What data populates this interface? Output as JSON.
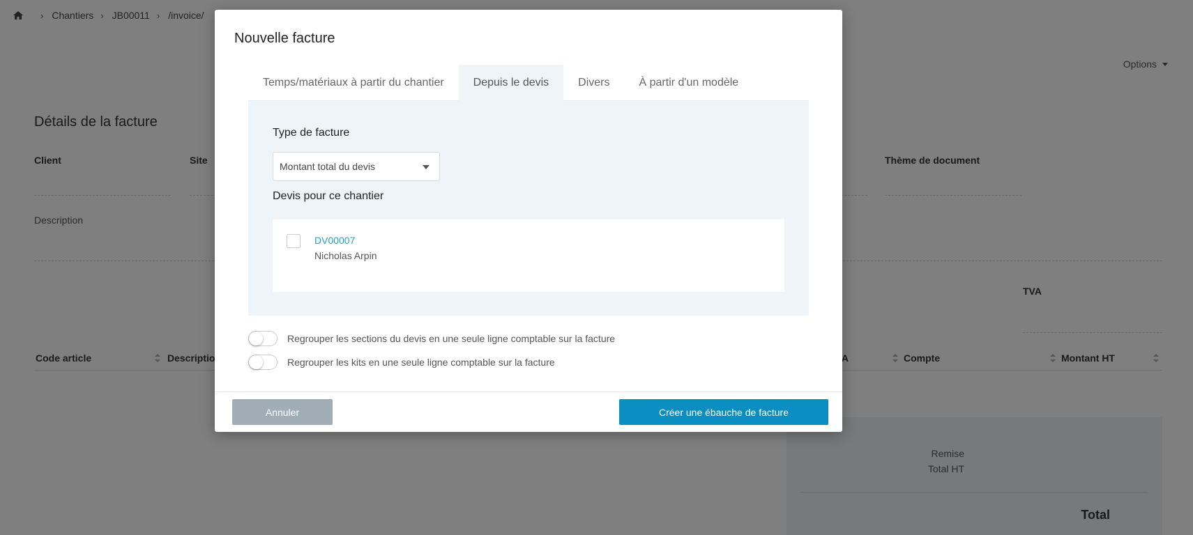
{
  "breadcrumb": {
    "items": [
      "Chantiers",
      "JB00011",
      "/invoice/"
    ]
  },
  "header": {
    "options_label": "Options"
  },
  "invoice_card": {
    "title": "Détails de la facture",
    "fields": {
      "client": "Client",
      "site": "Site",
      "theme": "Thème de document",
      "description": "Description",
      "tva": "TVA"
    },
    "table_headers": {
      "code": "Code article",
      "description": "Description",
      "tva": "TVA",
      "account": "Compte",
      "amount": "Montant HT"
    },
    "totals": {
      "discount": "Remise",
      "subtotal": "Total HT",
      "total": "Total"
    }
  },
  "modal": {
    "title": "Nouvelle facture",
    "tabs": [
      {
        "label": "Temps/matériaux à partir du chantier",
        "active": false
      },
      {
        "label": "Depuis le devis",
        "active": true
      },
      {
        "label": "Divers",
        "active": false
      },
      {
        "label": "À partir d'un modèle",
        "active": false
      }
    ],
    "invoice_type_label": "Type de facture",
    "invoice_type_value": "Montant total du devis",
    "quotes_label": "Devis pour ce chantier",
    "quotes": [
      {
        "number": "DV00007",
        "client": "Nicholas Arpin",
        "checked": false
      }
    ],
    "toggles": [
      {
        "label": "Regrouper les sections du devis en une seule ligne comptable sur la facture",
        "on": false
      },
      {
        "label": "Regrouper les kits en une seule ligne comptable sur la facture",
        "on": false
      }
    ],
    "cancel_label": "Annuler",
    "create_label": "Créer une ébauche de facture"
  },
  "colors": {
    "primary": "#0a8ec1",
    "link": "#2a9fc4",
    "cancel": "#a0adb5",
    "panel": "#eef4f7"
  }
}
